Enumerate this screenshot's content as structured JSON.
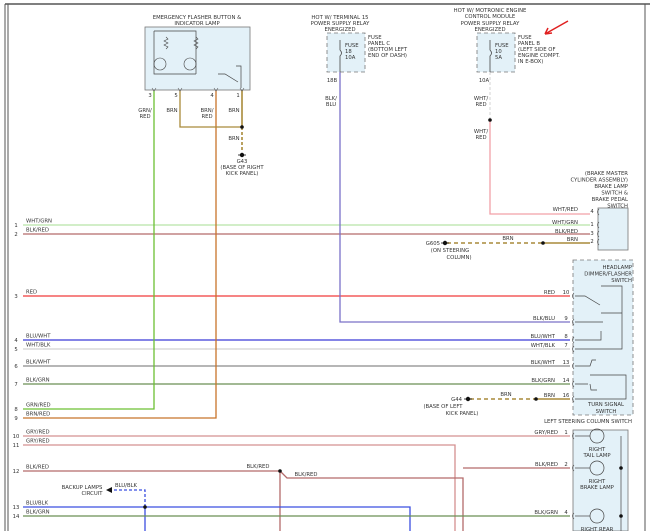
{
  "colors": {
    "WHT/GRN": "#b6e3a8",
    "BLK/RED": "#b46b6b",
    "RED": "#f03a3a",
    "BLU/WHT": "#3b3bd8",
    "WHT/BLK": "#d2d2d2",
    "BLK/WHT": "#8a8a8a",
    "BLK/GRN": "#6b8f55",
    "GRN/RED": "#6cc033",
    "BRN/RED": "#c8742a",
    "GRY/RED": "#d49090",
    "BLU/BLK": "#3b4fe0",
    "BLK/BLU": "#7a70c8",
    "WHT/RED": "#f2a0a8",
    "BRN": "#a98a3a",
    "component_fill": "#e3f1f8",
    "annotation_arrow": "#e02020"
  },
  "flasher": {
    "title_1": "EMERGENCY FLASHER BUTTON &",
    "title_2": "INDICATOR LAMP",
    "pins": [
      "3",
      "5",
      "4",
      "1"
    ],
    "wire_labels": [
      "GRN/",
      "RED",
      "BRN",
      "BRN/",
      "RED",
      "BRN"
    ],
    "brn_splice": "BRN",
    "ground": "G43",
    "ground_desc_1": "(BASE OF RIGHT",
    "ground_desc_2": "KICK PANEL)"
  },
  "fuse_c": {
    "hot_1": "HOT W/ TERMINAL 15",
    "hot_2": "POWER SUPPLY RELAY",
    "hot_3": "ENERGIZED",
    "fuse_1": "FUSE",
    "fuse_2": "18",
    "fuse_3": "10A",
    "panel_1": "FUSE",
    "panel_2": "PANEL C",
    "panel_3": "(BOTTOM LEFT",
    "panel_4": "END OF DASH)",
    "pin": "18B",
    "wire_1": "BLK/",
    "wire_2": "BLU"
  },
  "fuse_b": {
    "hot_1": "HOT W/ MOTRONIC ENGINE",
    "hot_2": "CONTROL MODULE",
    "hot_3": "POWER SUPPLY RELAY",
    "hot_4": "ENERGIZED",
    "fuse_1": "FUSE",
    "fuse_2": "10",
    "fuse_3": "5A",
    "panel_1": "FUSE",
    "panel_2": "PANEL B",
    "panel_3": "(LEFT SIDE OF",
    "panel_4": "ENGINE COMPT.",
    "panel_5": "IN E-BOX)",
    "pin": "10A",
    "wire_1": "WHT/",
    "wire_2": "RED",
    "wire_3": "WHT/",
    "wire_4": "RED"
  },
  "brake_switch": {
    "title": [
      "(BRAKE MASTER",
      "CYLINDER ASSEMBLY)",
      "BRAKE LAMP",
      "SWITCH &",
      "BRAKE PEDAL",
      "SWITCH"
    ],
    "pins": [
      {
        "label": "WHT/RED",
        "pin": "4"
      },
      {
        "label": "WHT/GRN",
        "pin": "1"
      },
      {
        "label": "BLK/RED",
        "pin": "3"
      },
      {
        "label": "BRN",
        "pin": "2"
      }
    ],
    "ground": "G605",
    "ground_desc_1": "(ON STEERING",
    "ground_desc_2": "COLUMN)",
    "ground_wire": "BRN"
  },
  "headlamp_switch": {
    "title": [
      "HEADLAMP",
      "DIMMER/FLASHER",
      "SWITCH"
    ],
    "turn_title": [
      "TURN SIGNAL",
      "SWITCH"
    ],
    "pins": [
      {
        "label": "RED",
        "pin": "10"
      },
      {
        "label": "BLK/BLU",
        "pin": "9"
      },
      {
        "label": "BLU/WHT",
        "pin": "8"
      },
      {
        "label": "WHT/BLK",
        "pin": "7"
      },
      {
        "label": "BLK/WHT",
        "pin": "13"
      },
      {
        "label": "BLK/GRN",
        "pin": "14"
      },
      {
        "label": "BRN",
        "pin": "16"
      }
    ],
    "ground": "G44",
    "ground_desc_1": "(BASE OF LEFT",
    "ground_desc_2": "KICK PANEL)",
    "ground_wire": "BRN"
  },
  "lamps": {
    "title": "LEFT STEERING COLUMN SWITCH",
    "pins": [
      {
        "label": "GRY/RED",
        "pin": "1",
        "lamp_1": "RIGHT",
        "lamp_2": "TAIL LAMP"
      },
      {
        "label": "BLK/RED",
        "pin": "2",
        "lamp_1": "RIGHT",
        "lamp_2": "BRAKE LAMP"
      },
      {
        "label": "BLK/GRN",
        "pin": "4",
        "lamp_1": "RIGHT REAR",
        "lamp_2": ""
      }
    ]
  },
  "left_connector": [
    {
      "pin": "1",
      "label": "WHT/GRN"
    },
    {
      "pin": "2",
      "label": "BLK/RED"
    },
    {
      "pin": "3",
      "label": "RED"
    },
    {
      "pin": "4",
      "label": "BLU/WHT"
    },
    {
      "pin": "5",
      "label": "WHT/BLK"
    },
    {
      "pin": "6",
      "label": "BLK/WHT"
    },
    {
      "pin": "7",
      "label": "BLK/GRN"
    },
    {
      "pin": "8",
      "label": "GRN/RED"
    },
    {
      "pin": "9",
      "label": "BRN/RED"
    },
    {
      "pin": "10",
      "label": "GRY/RED"
    },
    {
      "pin": "11",
      "label": "GRY/RED"
    },
    {
      "pin": "12",
      "label": "BLK/RED"
    },
    {
      "pin": "13",
      "label": "BLU/BLK"
    },
    {
      "pin": "14",
      "label": "BLK/GRN"
    }
  ],
  "splices": {
    "blk_red_1": "BLK/RED",
    "blk_red_2": "BLK/RED",
    "backup_1": "BACKUP LAMPS",
    "backup_2": "CIRCUIT",
    "backup_wire": "BLU/BLK"
  }
}
